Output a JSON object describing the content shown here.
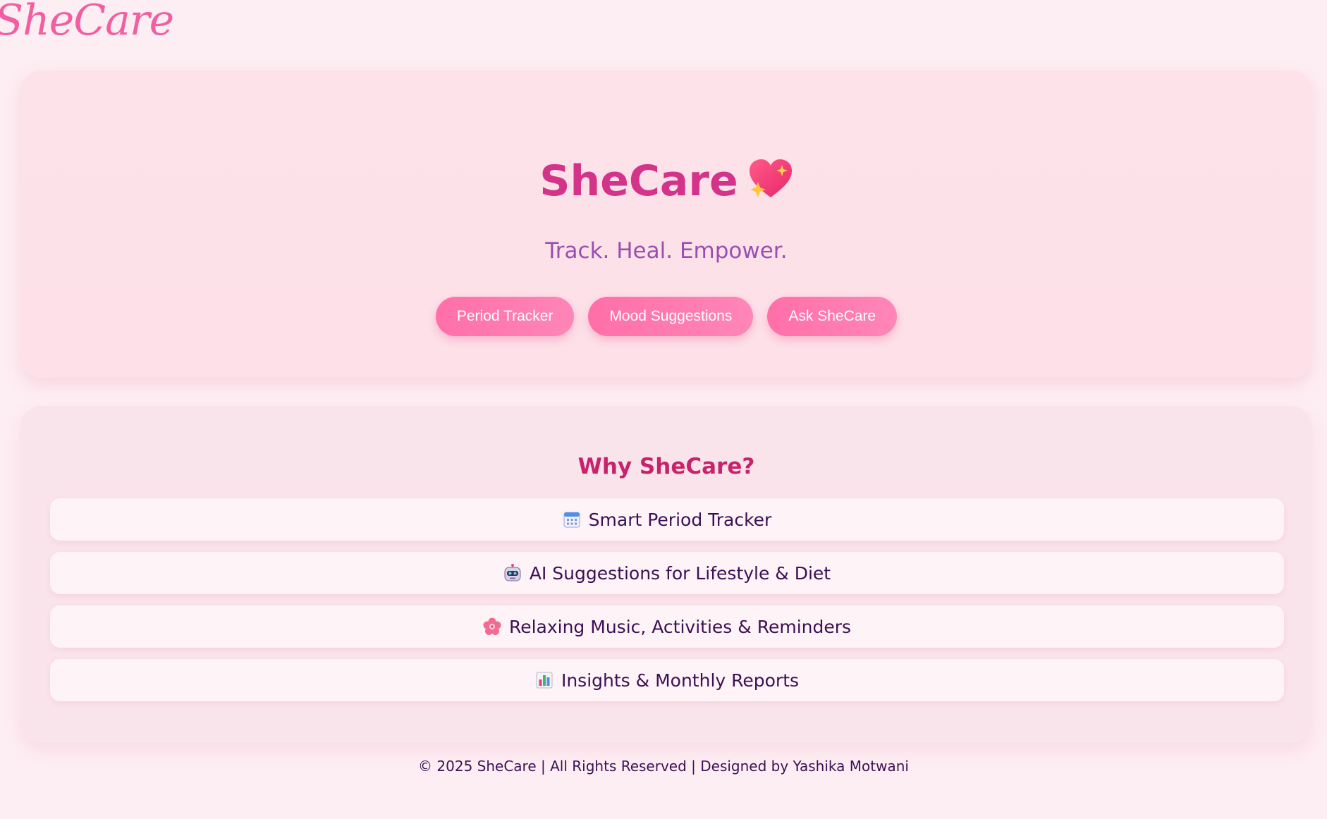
{
  "brand": {
    "logo_text": "SheCare"
  },
  "hero": {
    "title": "SheCare",
    "title_emoji": "sparkling-heart-icon",
    "tagline": "Track. Heal. Empower.",
    "buttons": [
      {
        "label": "Period Tracker"
      },
      {
        "label": "Mood Suggestions"
      },
      {
        "label": "Ask SheCare"
      }
    ]
  },
  "features": {
    "title": "Why SheCare?",
    "items": [
      {
        "icon": "calendar-icon",
        "label": "Smart Period Tracker"
      },
      {
        "icon": "robot-icon",
        "label": "AI Suggestions for Lifestyle & Diet"
      },
      {
        "icon": "cherry-blossom-icon",
        "label": "Relaxing Music, Activities & Reminders"
      },
      {
        "icon": "bar-chart-icon",
        "label": "Insights & Monthly Reports"
      }
    ]
  },
  "footer": {
    "text": "© 2025 SheCare | All Rights Reserved | Designed by Yashika Motwani"
  },
  "colors": {
    "page_bg": "#fdeef3",
    "logo": "#f15fa0",
    "hero_title": "#d4338a",
    "tagline": "#9a4fb0",
    "button": "#ff6fa8",
    "section_title": "#c8236a",
    "body_text": "#3b1054"
  }
}
